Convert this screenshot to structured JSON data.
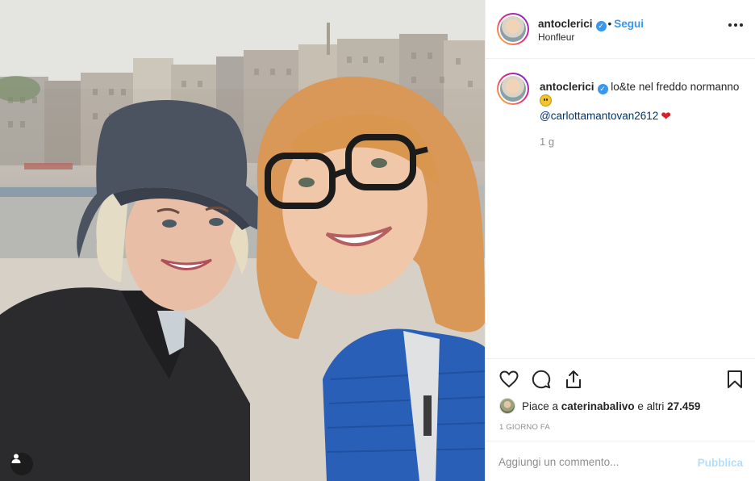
{
  "post": {
    "username": "antoclerici",
    "follow_label": "Segui",
    "dot": "•",
    "location": "Honfleur",
    "verified_icon": "verified-badge-icon",
    "caption": {
      "username": "antoclerici",
      "text": "lo&te nel freddo normanno",
      "mention": "@carlottamantovan2612",
      "emoji_1": "smiling-face-emoji",
      "emoji_2": "red-heart-emoji"
    },
    "time_ago": "1 g",
    "likes": {
      "prefix": "Piace a ",
      "user": "caterinabalivo",
      "middle": " e altri ",
      "count": "27.459"
    },
    "date": "1 GIORNO FA",
    "comment": {
      "placeholder": "Aggiungi un commento...",
      "publish_label": "Pubblica"
    }
  },
  "icons": {
    "like": "heart-outline-icon",
    "comment": "comment-bubble-icon",
    "share": "share-icon",
    "save": "bookmark-icon",
    "more": "more-options-icon",
    "user_tag": "user-tag-icon"
  },
  "colors": {
    "accent_blue": "#3897f0",
    "text": "#262626",
    "muted": "#8e8e8e",
    "publish_disabled": "#b2dffc",
    "border": "#efefef"
  }
}
